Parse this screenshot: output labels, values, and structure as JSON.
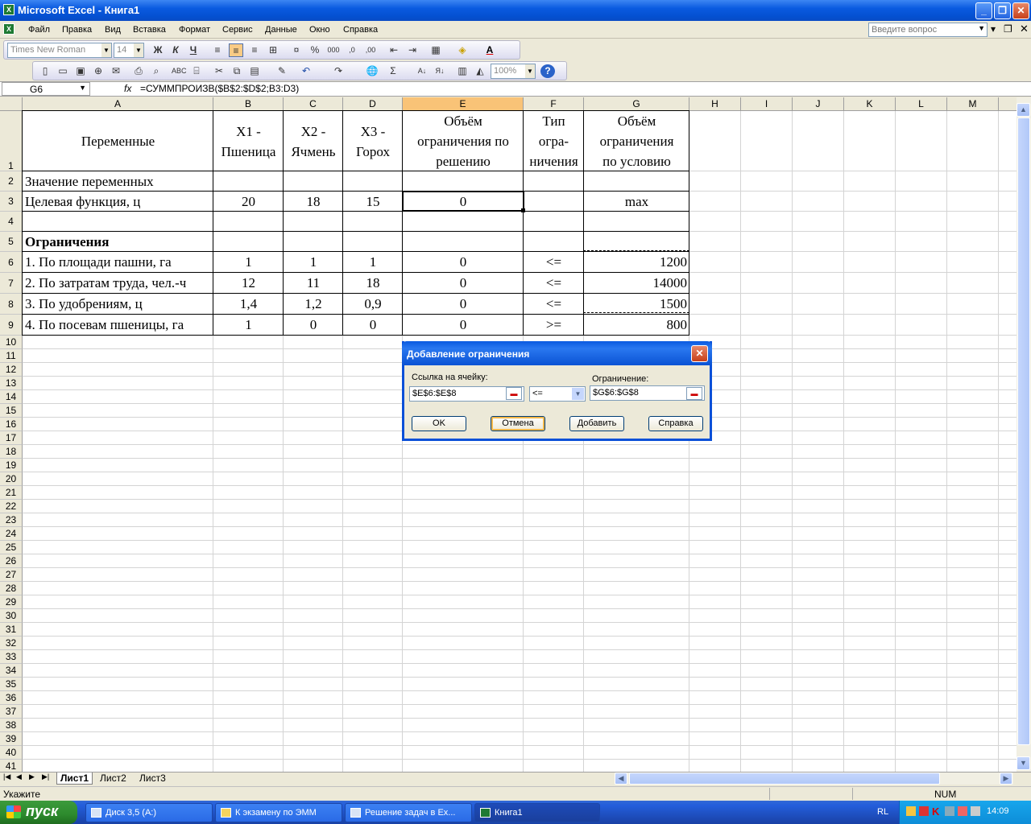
{
  "window": {
    "title": "Microsoft Excel - Книга1",
    "app_icon_glyph": "X"
  },
  "menu": [
    "Файл",
    "Правка",
    "Вид",
    "Вставка",
    "Формат",
    "Сервис",
    "Данные",
    "Окно",
    "Справка"
  ],
  "ask_placeholder": "Введите вопрос",
  "toolbar": {
    "font": "Times New Roman",
    "size": "14",
    "zoom": "100%",
    "bold": "Ж",
    "italic": "К",
    "underline": "Ч"
  },
  "formula_bar": {
    "name_box": "G6",
    "fx": "fx",
    "formula": "=СУММПРОИЗВ($B$2:$D$2;B3:D3)"
  },
  "columns": [
    "A",
    "B",
    "C",
    "D",
    "E",
    "F",
    "G",
    "H",
    "I",
    "J",
    "K",
    "L",
    "M"
  ],
  "rows": [
    "1",
    "2",
    "3",
    "4",
    "5",
    "6",
    "7",
    "8",
    "9",
    "10",
    "11",
    "12",
    "13",
    "14",
    "15",
    "16",
    "17",
    "18",
    "19",
    "20",
    "21",
    "22",
    "23",
    "24",
    "25",
    "26",
    "27",
    "28",
    "29",
    "30",
    "31",
    "32",
    "33",
    "34",
    "35",
    "36",
    "37",
    "38",
    "39",
    "40",
    "41"
  ],
  "header": {
    "a": "Переменные",
    "b": [
      "X1 -",
      "Пшеница"
    ],
    "c": [
      "X2 -",
      "Ячмень"
    ],
    "d": [
      "X3 -",
      "Горох"
    ],
    "e": [
      "Объём",
      "ограничения по",
      "решению"
    ],
    "f": [
      "Тип",
      "огра-",
      "ничения"
    ],
    "g": [
      "Объём",
      "ограничения",
      "по условию"
    ]
  },
  "table": [
    {
      "a": "Значение переменных",
      "b": "",
      "c": "",
      "d": "",
      "e": "",
      "f": "",
      "g": ""
    },
    {
      "a": "Целевая функция, ц",
      "b": "20",
      "c": "18",
      "d": "15",
      "e": "0",
      "f": "",
      "g": "max"
    },
    {
      "a": "",
      "b": "",
      "c": "",
      "d": "",
      "e": "",
      "f": "",
      "g": ""
    },
    {
      "a": "Ограничения",
      "b": "",
      "c": "",
      "d": "",
      "e": "",
      "f": "",
      "g": ""
    },
    {
      "a": "1. По площади пашни, га",
      "b": "1",
      "c": "1",
      "d": "1",
      "e": "0",
      "f": "<=",
      "g": "1200"
    },
    {
      "a": "2. По затратам труда, чел.-ч",
      "b": "12",
      "c": "11",
      "d": "18",
      "e": "0",
      "f": "<=",
      "g": "14000"
    },
    {
      "a": "3. По удобрениям, ц",
      "b": "1,4",
      "c": "1,2",
      "d": "0,9",
      "e": "0",
      "f": "<=",
      "g": "1500"
    },
    {
      "a": "4. По посевам пшеницы, га",
      "b": "1",
      "c": "0",
      "d": "0",
      "e": "0",
      "f": ">=",
      "g": "800"
    }
  ],
  "dialog": {
    "title": "Добавление ограничения",
    "ref_label": "Ссылка на ячейку:",
    "ref_value": "$E$6:$E$8",
    "op_value": "<=",
    "constraint_label": "Ограничение:",
    "constraint_value": "$G$6:$G$8",
    "buttons": {
      "ok": "OK",
      "cancel": "Отмена",
      "add": "Добавить",
      "help": "Справка"
    }
  },
  "sheets": [
    "Лист1",
    "Лист2",
    "Лист3"
  ],
  "status": {
    "left": "Укажите",
    "num": "NUM"
  },
  "taskbar": {
    "start": "пуск",
    "tasks": [
      "Диск 3,5 (A:)",
      "К экзамену по ЭММ",
      "Решение задач в Ex...",
      "Книга1"
    ],
    "lang": "RL",
    "clock": "14:09"
  }
}
